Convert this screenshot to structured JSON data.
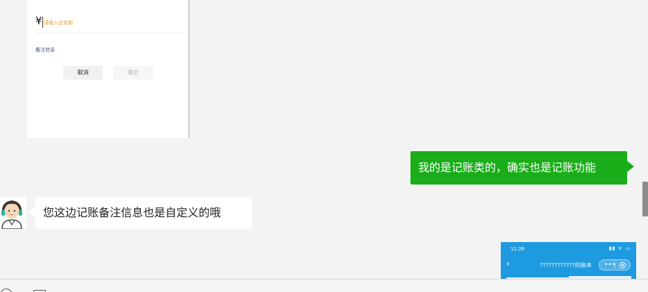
{
  "shot_top": {
    "currency_symbol": "¥",
    "amount_placeholder": "请输入总金额",
    "remark_label": "备注信息",
    "cancel_label": "取消",
    "confirm_label": "确定"
  },
  "messages": [
    {
      "side": "right",
      "text": "我的是记账类的，确实也是记账功能"
    },
    {
      "side": "left",
      "text": "您这边记账备注信息也是自定义的哦"
    }
  ],
  "shot_bottom": {
    "time": "11:26",
    "status_icons": "▮▮ ᯤ ▭",
    "back_icon": "‹",
    "title": "????????????的账本",
    "capsule_dots": "•••"
  },
  "colors": {
    "my_bubble": "#1aad19",
    "phone_header": "#1e9be0",
    "placeholder": "#f0a020"
  },
  "icons": [
    "avatar-agent",
    "chevron-left-icon",
    "more-dots-icon",
    "target-icon",
    "emoji-icon",
    "file-icon"
  ]
}
